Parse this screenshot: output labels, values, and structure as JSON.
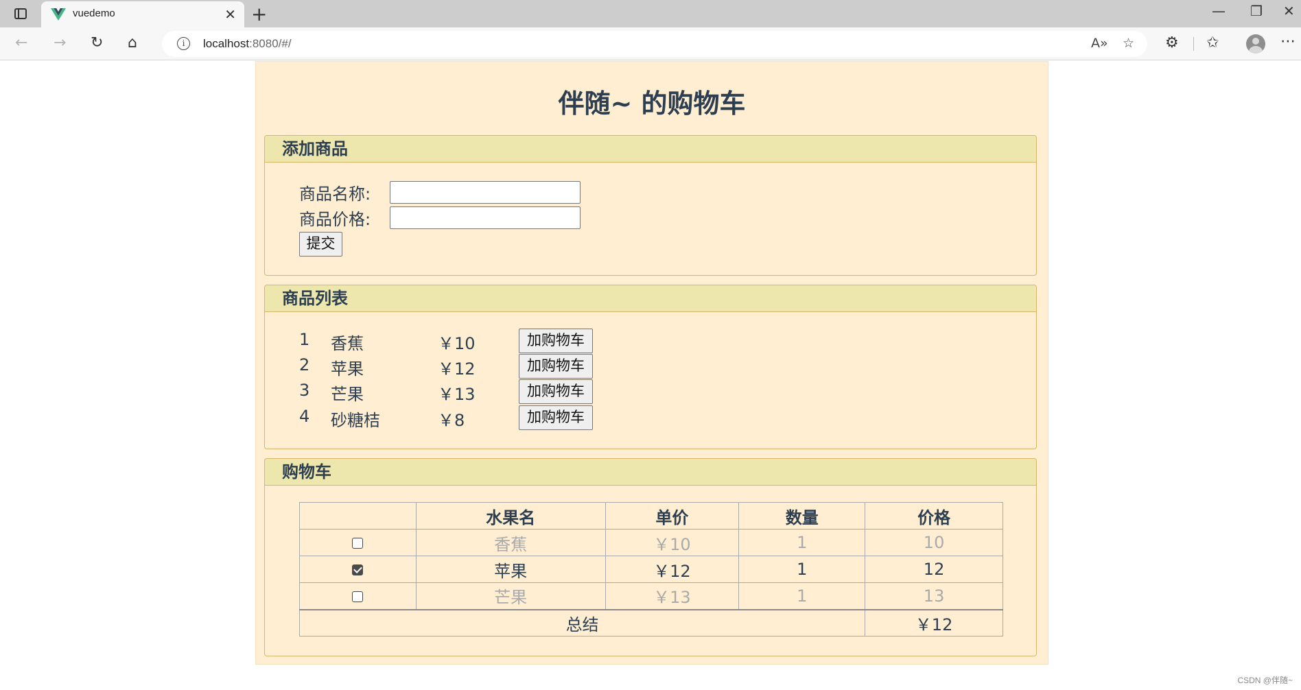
{
  "browser": {
    "tab_title": "vuedemo",
    "tab_close": "✕",
    "new_tab": "+",
    "url_host": "localhost",
    "url_path": ":8080/#/",
    "window_controls": {
      "minimize": "—",
      "restore": "❐",
      "close": "✕"
    }
  },
  "page": {
    "title": "伴随~ 的购物车",
    "add_section": {
      "heading": "添加商品",
      "name_label": "商品名称:",
      "name_value": "",
      "price_label": "商品价格:",
      "price_value": "",
      "submit_label": "提交"
    },
    "product_section": {
      "heading": "商品列表",
      "add_button_label": "加购物车",
      "products": [
        {
          "id": "1",
          "name": "香蕉",
          "price": "￥10"
        },
        {
          "id": "2",
          "name": "苹果",
          "price": "￥12"
        },
        {
          "id": "3",
          "name": "芒果",
          "price": "￥13"
        },
        {
          "id": "4",
          "name": "砂糖桔",
          "price": "￥8"
        }
      ]
    },
    "cart_section": {
      "heading": "购物车",
      "columns": [
        "",
        "水果名",
        "单价",
        "数量",
        "价格"
      ],
      "rows": [
        {
          "checked": false,
          "name": "香蕉",
          "unit_price": "￥10",
          "qty": "1",
          "price": "10"
        },
        {
          "checked": true,
          "name": "苹果",
          "unit_price": "￥12",
          "qty": "1",
          "price": "12"
        },
        {
          "checked": false,
          "name": "芒果",
          "unit_price": "￥13",
          "qty": "1",
          "price": "13"
        }
      ],
      "summary_label": "总结",
      "summary_total": "￥12"
    }
  },
  "watermark": "CSDN @伴随~"
}
